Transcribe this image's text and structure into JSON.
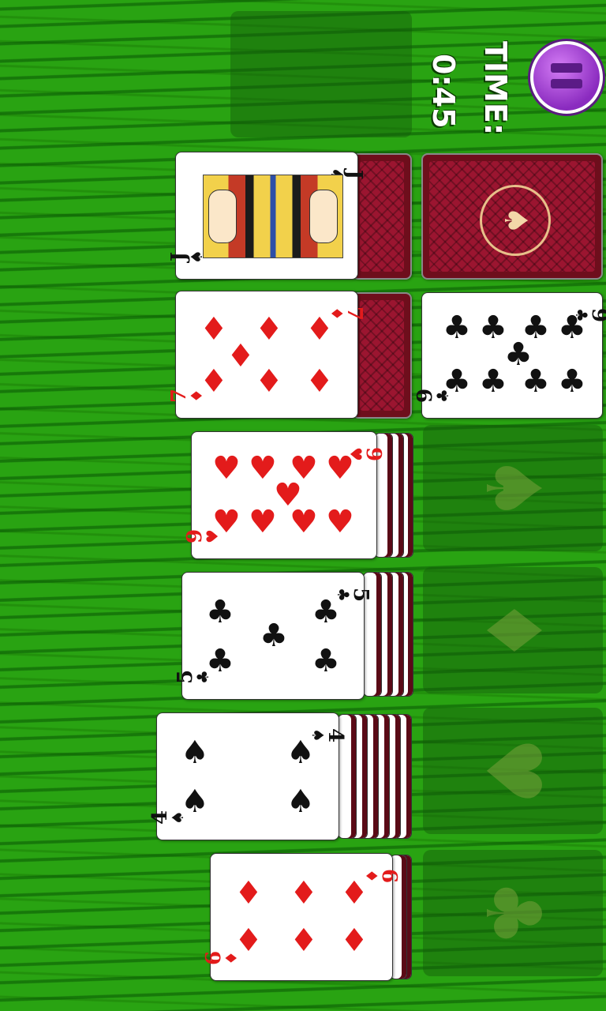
{
  "hud": {
    "time_label": "TIME:",
    "time_value": "0:45",
    "pause_icon": "pause-icon"
  },
  "stock": {
    "label": "draw pile",
    "icon": "spade-emblem-icon"
  },
  "waste": {
    "rank": "J",
    "suit": "♠",
    "color": "black"
  },
  "tableau": [
    {
      "rank": "7",
      "suit": "♦",
      "color": "red"
    },
    {
      "rank": "9",
      "suit": "♥",
      "color": "red"
    },
    {
      "rank": "5",
      "suit": "♣",
      "color": "black"
    },
    {
      "rank": "4",
      "suit": "♠",
      "color": "black"
    },
    {
      "rank": "6",
      "suit": "♦",
      "color": "red"
    }
  ],
  "column2_top": {
    "rank": "9",
    "suit": "♣",
    "color": "black"
  },
  "foundations": [
    {
      "suit_icon": "spade-outline-icon",
      "glyph": "♠"
    },
    {
      "suit_icon": "diamond-outline-icon",
      "glyph": "♦"
    },
    {
      "suit_icon": "heart-outline-icon",
      "glyph": "♥"
    },
    {
      "suit_icon": "club-outline-icon",
      "glyph": "♣"
    }
  ],
  "colors": {
    "felt": "#29a312",
    "card_back": "#9b1530",
    "pause_button": "#8a2bbf",
    "red_suit": "#e31b1b"
  }
}
